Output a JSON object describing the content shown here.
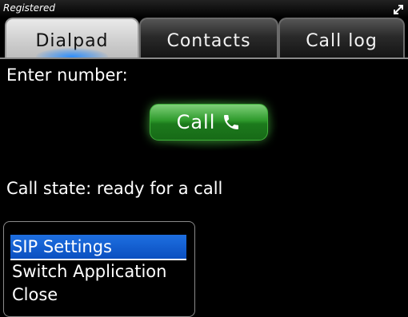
{
  "status": {
    "text": "Registered",
    "expand_icon": "expand-arrows-icon"
  },
  "tabs": [
    {
      "label": "Dialpad",
      "active": true
    },
    {
      "label": "Contacts",
      "active": false
    },
    {
      "label": "Call log",
      "active": false
    }
  ],
  "dialpad": {
    "enter_label": "Enter number:",
    "call_label": "Call",
    "call_icon": "phone-handset-icon",
    "call_state": "Call state: ready for a call"
  },
  "menu": {
    "items": [
      {
        "label": "SIP Settings",
        "selected": true
      },
      {
        "label": "Switch Application",
        "selected": false
      },
      {
        "label": "Close",
        "selected": false
      }
    ]
  },
  "colors": {
    "accent_tab_glow": "#288cff",
    "call_button": "#2f9a2c",
    "menu_selection": "#1e6fe0"
  }
}
